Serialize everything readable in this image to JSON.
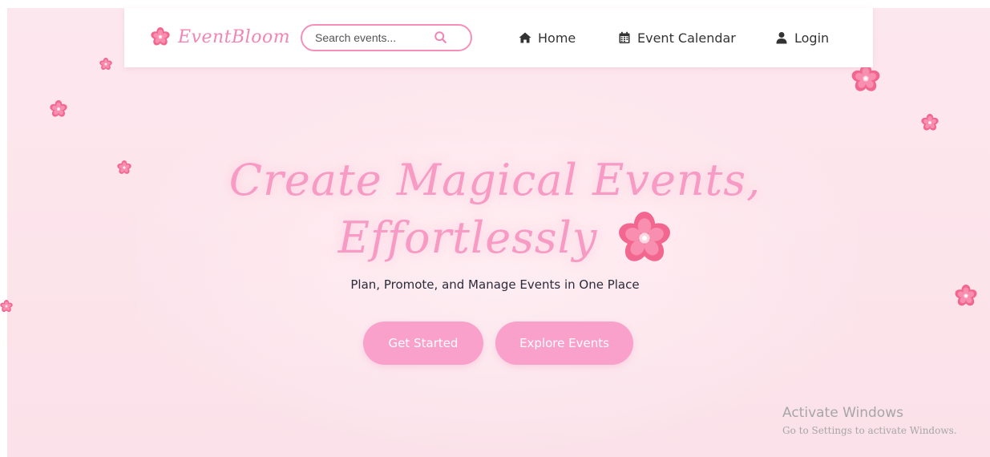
{
  "navbar": {
    "brand": "EventBloom",
    "search_placeholder": "Search events...",
    "home_label": "Home",
    "calendar_label": "Event Calendar",
    "login_label": "Login"
  },
  "hero": {
    "title_line1": "Create Magical Events,",
    "title_line2": "Effortlessly",
    "subtitle": "Plan, Promote, and Manage Events in One Place",
    "primary_button": "Get Started",
    "secondary_button": "Explore Events"
  },
  "watermark": {
    "title": "Activate Windows",
    "subtitle": "Go to Settings to activate Windows."
  },
  "icons": {
    "brand": "cherry-blossom-icon",
    "search": "search-icon",
    "home": "home-icon",
    "calendar": "calendar-icon",
    "login": "user-icon"
  },
  "colors": {
    "accent": "#f285b5",
    "button": "#f9a0cb",
    "headline": "#f79ac4",
    "background": "#fde6ed",
    "flower": "#f2668f"
  }
}
